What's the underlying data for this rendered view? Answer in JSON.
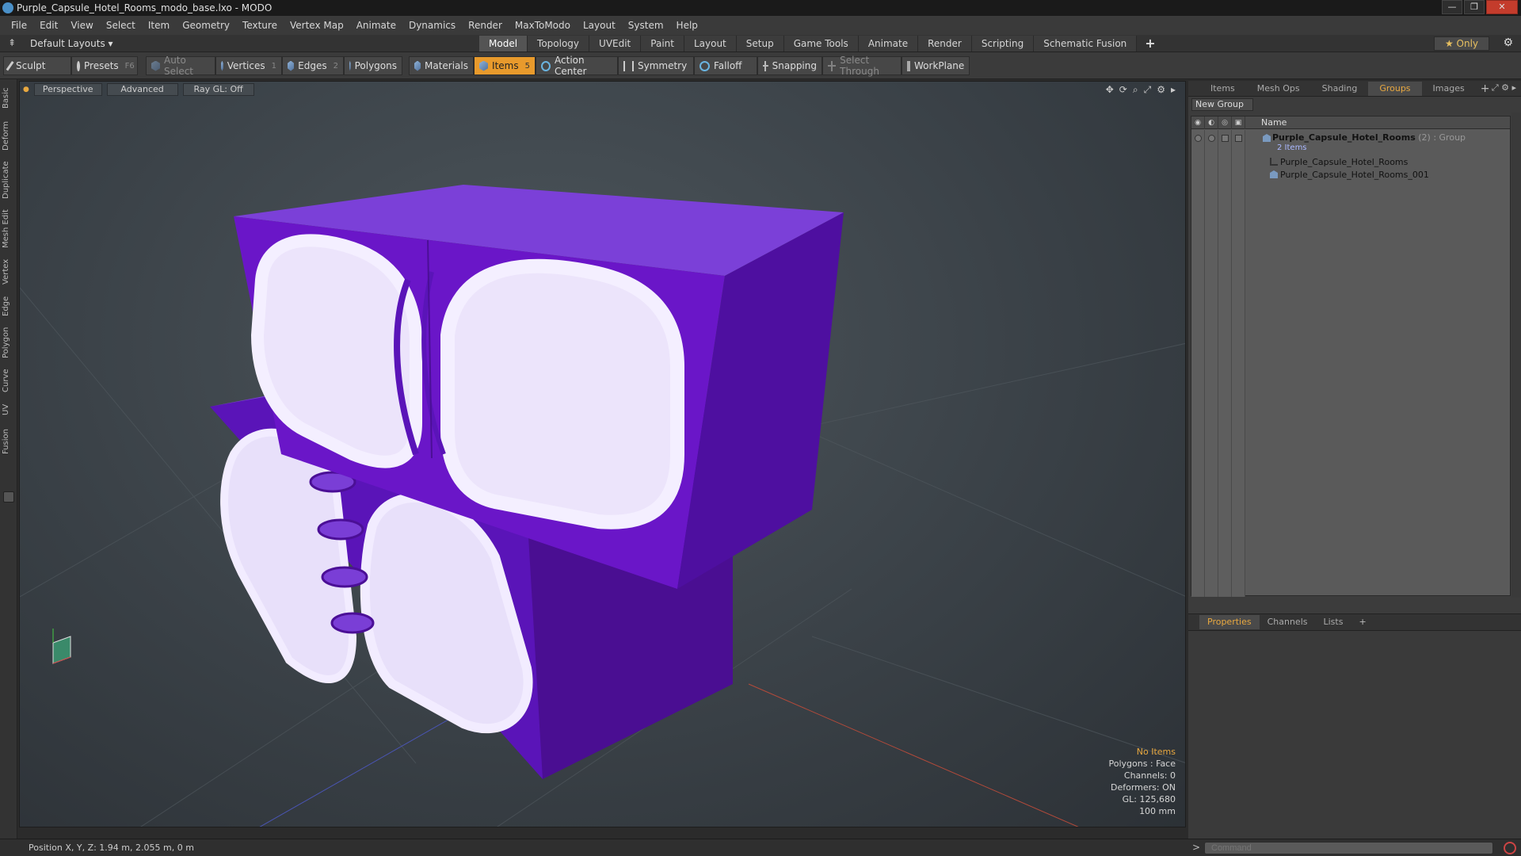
{
  "window": {
    "title": "Purple_Capsule_Hotel_Rooms_modo_base.lxo - MODO",
    "controls": [
      "—",
      "❐",
      "✕"
    ]
  },
  "menu": [
    "File",
    "Edit",
    "View",
    "Select",
    "Item",
    "Geometry",
    "Texture",
    "Vertex Map",
    "Animate",
    "Dynamics",
    "Render",
    "MaxToModo",
    "Layout",
    "System",
    "Help"
  ],
  "layout": {
    "layouts_label": "Default Layouts ▾",
    "tabs": [
      "Model",
      "Topology",
      "UVEdit",
      "Paint",
      "Layout",
      "Setup",
      "Game Tools",
      "Animate",
      "Render",
      "Scripting",
      "Schematic Fusion"
    ],
    "active_tab": "Model",
    "plus": "+",
    "only_label": "★  Only"
  },
  "toolbar": {
    "sculpt": "Sculpt",
    "presets": "Presets",
    "presets_hotkey": "F6",
    "auto_select": "Auto Select",
    "vertices": "Vertices",
    "vertices_count": "1",
    "edges": "Edges",
    "edges_count": "2",
    "polygons": "Polygons",
    "materials": "Materials",
    "items": "Items",
    "items_count": "5",
    "action_center": "Action Center",
    "symmetry": "Symmetry",
    "falloff": "Falloff",
    "snapping": "Snapping",
    "select_through": "Select Through",
    "workplane": "WorkPlane"
  },
  "left_tabs": [
    "Basic",
    "Deform",
    "Duplicate",
    "Mesh Edit",
    "Vertex",
    "Edge",
    "Polygon",
    "Curve",
    "UV",
    "Fusion"
  ],
  "viewport": {
    "perspective": "Perspective",
    "advanced": "Advanced",
    "raygl": "Ray GL: Off",
    "icons": [
      "✥",
      "⟳",
      "⌕",
      "⤢",
      "⚙",
      "▸"
    ],
    "info": {
      "no_items": "No Items",
      "polygons": "Polygons : Face",
      "channels": "Channels: 0",
      "deformers": "Deformers: ON",
      "gl": "GL: 125,680",
      "scale": "100 mm"
    },
    "colors": {
      "purple": "#6a16c8",
      "purple_dark": "#4b0f96",
      "lining": "#e6dcfa",
      "warn": "#e8a840"
    }
  },
  "right_panel": {
    "tabs": [
      "Items",
      "Mesh Ops",
      "Shading",
      "Groups",
      "Images"
    ],
    "active_tab": "Groups",
    "plus": "+",
    "new_group": "New Group",
    "column_name": "Name",
    "group_name": "Purple_Capsule_Hotel_Rooms",
    "group_suffix": "(2) : Group",
    "group_count": "2 Items",
    "children": [
      "Purple_Capsule_Hotel_Rooms",
      "Purple_Capsule_Hotel_Rooms_001"
    ],
    "props_tabs": [
      "Properties",
      "Channels",
      "Lists"
    ],
    "props_active": "Properties"
  },
  "status": {
    "position": "Position X, Y, Z:   1.94 m, 2.055 m, 0 m",
    "command_placeholder": "Command",
    "prompt": ">"
  }
}
